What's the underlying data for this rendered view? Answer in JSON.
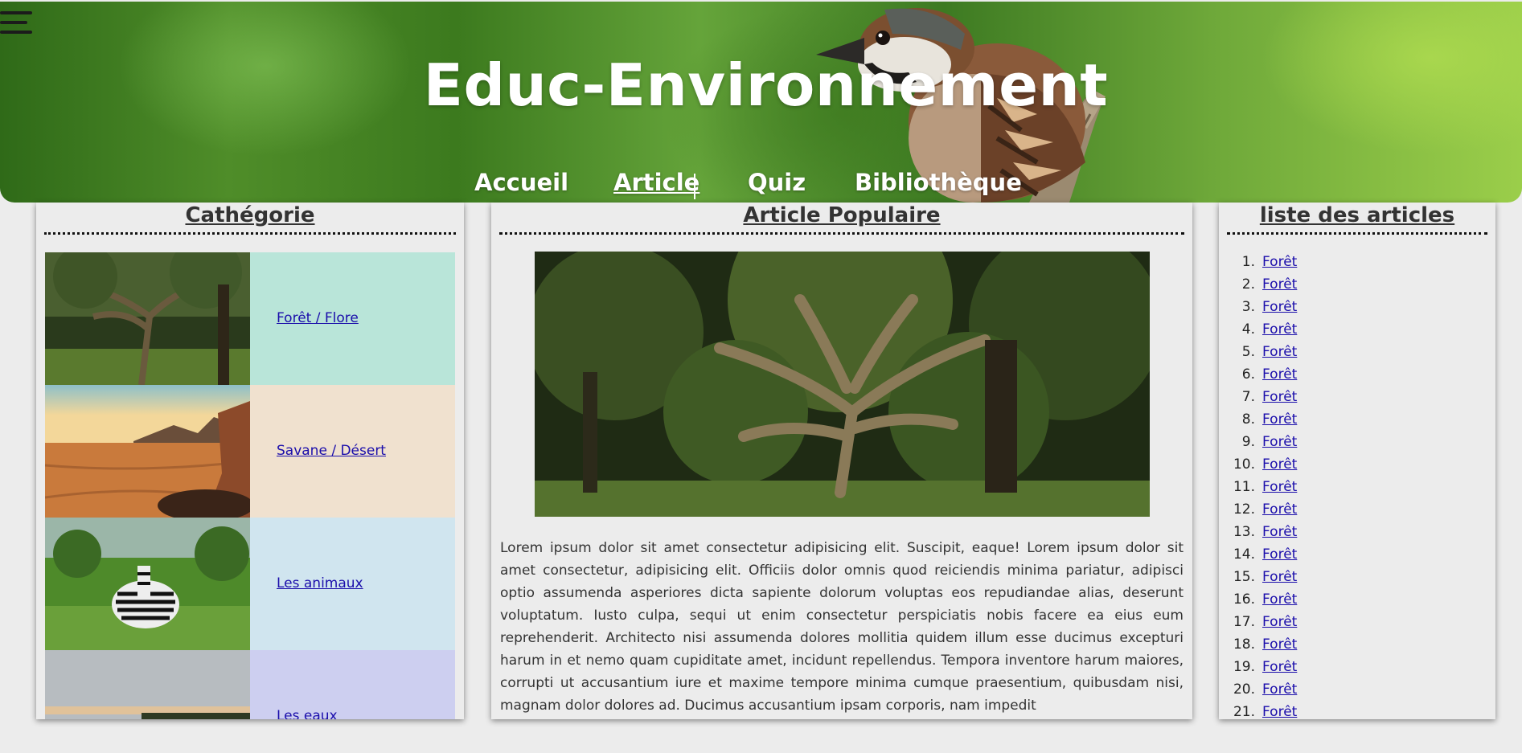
{
  "header": {
    "site_title": "Educ-Environnement",
    "menu_icon": "hamburger-menu-icon",
    "nav": [
      {
        "label": "Accueil"
      },
      {
        "label": "Article",
        "active": true
      },
      {
        "label": "Quiz"
      },
      {
        "label": "Bibliothèque"
      }
    ]
  },
  "categories": {
    "title": "Cathégorie",
    "items": [
      {
        "label": "Forêt / Flore",
        "color": "#b9e5d9"
      },
      {
        "label": "Savane / Désert",
        "color": "#f0e1cf"
      },
      {
        "label": "Les animaux",
        "color": "#d0e5ef"
      },
      {
        "label": "Les eaux",
        "color": "#cdcff0"
      }
    ]
  },
  "article": {
    "title": "Article Populaire",
    "text": "Lorem ipsum dolor sit amet consectetur adipisicing elit. Suscipit, eaque! Lorem ipsum dolor sit amet consectetur, adipisicing elit. Officiis dolor omnis quod reiciendis minima pariatur, adipisci optio assumenda asperiores dicta sapiente dolorum voluptas eos repudiandae alias, deserunt voluptatum. Iusto culpa, sequi ut enim consectetur perspiciatis nobis facere ea eius eum reprehenderit. Architecto nisi assumenda dolores mollitia quidem illum esse ducimus excepturi harum in et nemo quam cupiditate amet, incidunt repellendus. Tempora inventore harum maiores, corrupti ut accusantium iure et maxime tempore minima cumque praesentium, quibusdam nisi, magnam dolor dolores ad. Ducimus accusantium ipsam corporis, nam impedit"
  },
  "articles_list": {
    "title": "liste des articles",
    "items": [
      {
        "num": "1.",
        "label": "Forêt"
      },
      {
        "num": "2.",
        "label": "Forêt"
      },
      {
        "num": "3.",
        "label": "Forêt"
      },
      {
        "num": "4.",
        "label": "Forêt"
      },
      {
        "num": "5.",
        "label": "Forêt"
      },
      {
        "num": "6.",
        "label": "Forêt"
      },
      {
        "num": "7.",
        "label": "Forêt"
      },
      {
        "num": "8.",
        "label": "Forêt"
      },
      {
        "num": "9.",
        "label": "Forêt"
      },
      {
        "num": "10.",
        "label": "Forêt"
      },
      {
        "num": "11.",
        "label": "Forêt"
      },
      {
        "num": "12.",
        "label": "Forêt"
      },
      {
        "num": "13.",
        "label": "Forêt"
      },
      {
        "num": "14.",
        "label": "Forêt"
      },
      {
        "num": "15.",
        "label": "Forêt"
      },
      {
        "num": "16.",
        "label": "Forêt"
      },
      {
        "num": "17.",
        "label": "Forêt"
      },
      {
        "num": "18.",
        "label": "Forêt"
      },
      {
        "num": "19.",
        "label": "Forêt"
      },
      {
        "num": "20.",
        "label": "Forêt"
      },
      {
        "num": "21.",
        "label": "Forêt"
      }
    ]
  }
}
